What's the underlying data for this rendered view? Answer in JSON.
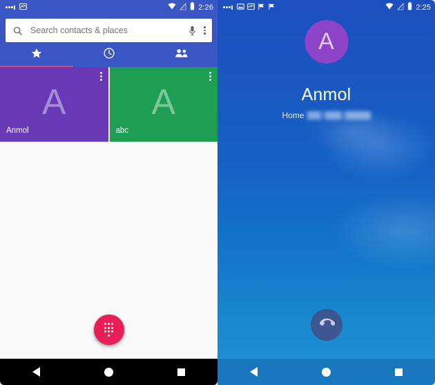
{
  "dialer": {
    "statusbar": {
      "notification_icons": [
        "ellipsis-icon",
        "chart-icon"
      ],
      "wifi_icon": "wifi-icon",
      "signal_icon": "signal-off-icon",
      "battery_icon": "battery-icon",
      "time": "2:26"
    },
    "search": {
      "placeholder": "Search contacts & places",
      "value": "",
      "search_icon": "search-icon",
      "mic_icon": "microphone-icon",
      "overflow_icon": "more-options-icon"
    },
    "tabs": [
      {
        "name": "favorites",
        "icon": "star-icon",
        "selected": true
      },
      {
        "name": "recents",
        "icon": "clock-icon",
        "selected": false
      },
      {
        "name": "contacts",
        "icon": "people-icon",
        "selected": false
      }
    ],
    "indicator_color": "#e8436f",
    "favorites": [
      {
        "name": "Anmol",
        "letter": "A",
        "color": "#6739b7"
      },
      {
        "name": "abc",
        "letter": "A",
        "color": "#1e9e52"
      }
    ],
    "fab": {
      "icon": "dialpad-icon",
      "color": "#e91e56"
    },
    "navbar": {
      "back": "back-icon",
      "home": "home-icon",
      "recents": "recents-icon"
    }
  },
  "call": {
    "statusbar": {
      "notification_icons": [
        "ellipsis-icon",
        "image-icon",
        "chart-icon",
        "flag-icon",
        "flag-icon"
      ],
      "wifi_icon": "wifi-icon",
      "signal_icon": "signal-off-icon",
      "battery_icon": "battery-icon",
      "time": "2:25"
    },
    "avatar": {
      "letter": "A",
      "color": "#8e44c8"
    },
    "contact_name": "Anmol",
    "number_label": "Home",
    "number_value": "",
    "end_call": {
      "icon": "end-call-icon"
    },
    "navbar": {
      "back": "back-icon",
      "home": "home-icon",
      "recents": "recents-icon"
    }
  }
}
